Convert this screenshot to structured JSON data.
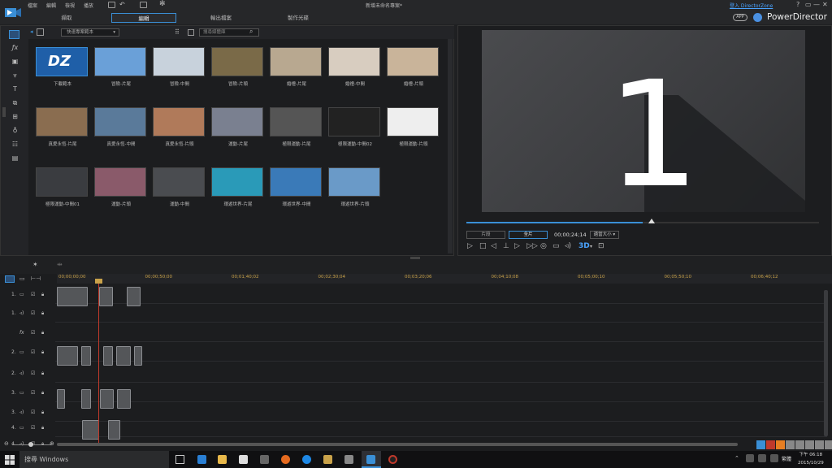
{
  "menu": [
    "檔案",
    "編輯",
    "檢視",
    "播放"
  ],
  "project_name": "新增未命名專案*",
  "tabs": [
    "擷取",
    "編輯",
    "輸出檔案",
    "製作光碟"
  ],
  "active_tab": "編輯",
  "login": "登入 DirectorZone",
  "app_badge": "APP",
  "app_name": "PowerDirector",
  "window_controls": [
    "?",
    "▭",
    "—",
    "▢",
    "✕"
  ],
  "library": {
    "dropdown": "快速專案範本",
    "search_placeholder": "搜尋媒體庫",
    "items": [
      {
        "label": "下載範本",
        "color": "#1f5fa8"
      },
      {
        "label": "冒險-片尾",
        "color": "#6aa0d8"
      },
      {
        "label": "冒險-中間",
        "color": "#c8d2dc"
      },
      {
        "label": "冒險-片頭",
        "color": "#7a6a48"
      },
      {
        "label": "婚禮-片尾",
        "color": "#b8a890"
      },
      {
        "label": "婚禮-中間",
        "color": "#d8cdc0"
      },
      {
        "label": "婚禮-片頭",
        "color": "#c9b49a"
      },
      {
        "label": "真愛永恆-片尾",
        "color": "#8a6d50"
      },
      {
        "label": "真愛永恆-中間",
        "color": "#5a7a9a"
      },
      {
        "label": "真愛永恆-片頭",
        "color": "#b07a5a"
      },
      {
        "label": "運動-片尾",
        "color": "#7a8090"
      },
      {
        "label": "極限運動-片尾",
        "color": "#555"
      },
      {
        "label": "極限運動-中間02",
        "color": "#222"
      },
      {
        "label": "極限運動-片頭",
        "color": "#eee"
      },
      {
        "label": "極限運動-中間01",
        "color": "#3a3c40"
      },
      {
        "label": "運動-片頭",
        "color": "#8a5a6a"
      },
      {
        "label": "運動-中間",
        "color": "#4a4c50"
      },
      {
        "label": "環遊世界-片尾",
        "color": "#2a9ab8"
      },
      {
        "label": "環遊世界-中間",
        "color": "#3a7ab8"
      },
      {
        "label": "環遊世界-片頭",
        "color": "#6a9ac8"
      }
    ]
  },
  "preview": {
    "big_number": "1",
    "segment_clip": "片段",
    "segment_movie": "全片",
    "timecode": "00;00;24;14",
    "fit_label": "適當大小",
    "badge_3d": "3D",
    "progress": 0.5
  },
  "ruler": [
    "00;00;00;00",
    "00;00;50;00",
    "00;01;40;02",
    "00;02;30;04",
    "00;03;20;06",
    "00;04;10;08",
    "00;05;00;10",
    "00;05;50;10",
    "00;06;40;12"
  ],
  "tracks": [
    "1.",
    "1.",
    "fx",
    "2.",
    "2.",
    "3.",
    "3.",
    "4.",
    "4."
  ],
  "taskbar": {
    "search": "搜尋 Windows",
    "time": "下午 06:18",
    "date": "2015/10/29",
    "ime": "繁體"
  }
}
